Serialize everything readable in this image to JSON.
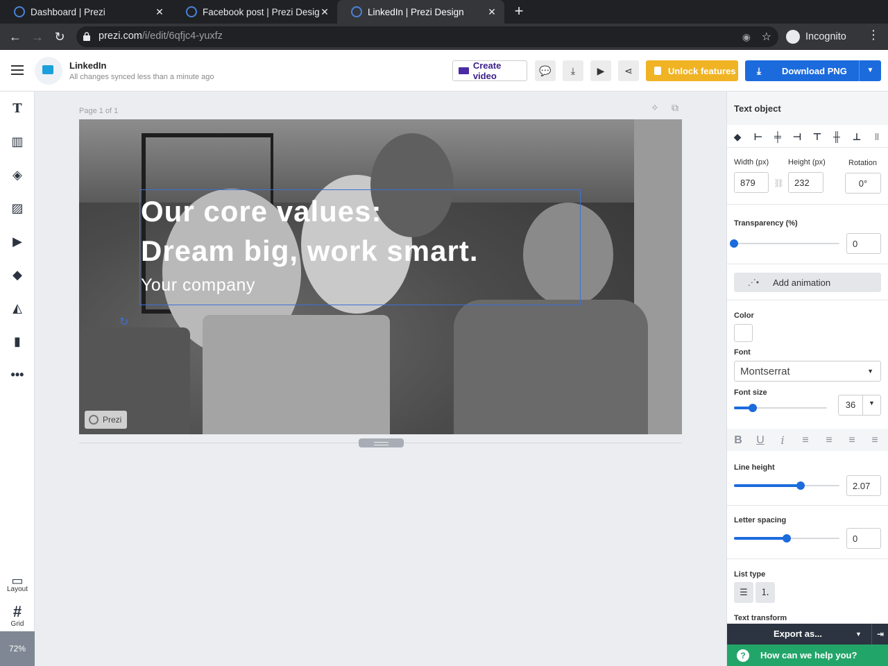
{
  "browser": {
    "tabs": [
      {
        "title": "Dashboard | Prezi",
        "active": false
      },
      {
        "title": "Facebook post | Prezi Desig",
        "active": false
      },
      {
        "title": "LinkedIn | Prezi Design",
        "active": true
      }
    ],
    "url_host": "prezi.com",
    "url_path": "/i/edit/6qfjc4-yuxfz",
    "profile": "Incognito"
  },
  "header": {
    "doc_title": "LinkedIn",
    "sync_status": "All changes synced less than a minute ago",
    "create_video": "Create video",
    "unlock": "Unlock features",
    "download": "Download PNG"
  },
  "toolbar": {
    "layout": "Layout",
    "grid": "Grid",
    "zoom": "72%"
  },
  "canvas": {
    "page_label": "Page 1 of 1",
    "headline_1": "Our core values:",
    "headline_2": "Dream big, work smart.",
    "subline": "Your company",
    "badge": "Prezi"
  },
  "panel": {
    "title": "Text object",
    "width_label": "Width (px)",
    "width_value": "879",
    "height_label": "Height (px)",
    "height_value": "232",
    "rotation_label": "Rotation",
    "rotation_value": "0°",
    "transparency_label": "Transparency (%)",
    "transparency_value": "0",
    "transparency_fraction": 0,
    "add_animation": "Add animation",
    "color_label": "Color",
    "text_color": "#ffffff",
    "font_label": "Font",
    "font_value": "Montserrat",
    "font_size_label": "Font size",
    "font_size_value": "36",
    "font_size_fraction": 0.2,
    "line_height_label": "Line height",
    "line_height_value": "2.07",
    "line_height_fraction": 0.63,
    "letter_spacing_label": "Letter spacing",
    "letter_spacing_value": "0",
    "letter_spacing_fraction": 0.5,
    "list_type_label": "List type",
    "text_transform_label": "Text transform",
    "export": "Export as...",
    "help": "How can we help you?"
  },
  "colors": {
    "accent": "#1c6bdd",
    "unlock": "#f0b323",
    "help": "#22a568"
  }
}
